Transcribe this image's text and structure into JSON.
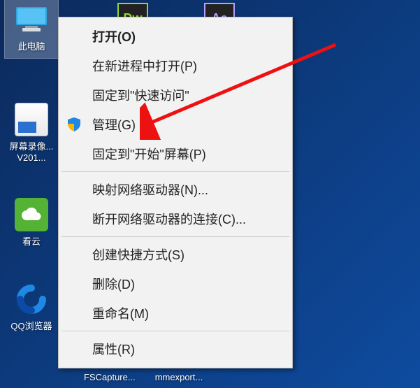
{
  "desktop": {
    "icons": [
      {
        "label": "此电脑",
        "kind": "this-pc",
        "selected": true
      },
      {
        "label": "屏幕录像...\nV201...",
        "kind": "recorder"
      },
      {
        "label": "看云",
        "kind": "cloud"
      },
      {
        "label": "QQ浏览器",
        "kind": "browser"
      }
    ],
    "topApps": [
      {
        "code": "Dw",
        "name": "dreamweaver"
      },
      {
        "code": "Ae",
        "name": "after-effects"
      }
    ],
    "bottomLabels": [
      "FSCapture...",
      "mmexport..."
    ]
  },
  "contextMenu": {
    "groups": [
      [
        {
          "id": "open",
          "label": "打开(O)",
          "bold": true
        },
        {
          "id": "open-new-process",
          "label": "在新进程中打开(P)"
        },
        {
          "id": "pin-quick-access",
          "label": "固定到\"快速访问\""
        },
        {
          "id": "manage",
          "label": "管理(G)",
          "shield": true
        },
        {
          "id": "pin-start",
          "label": "固定到\"开始\"屏幕(P)"
        }
      ],
      [
        {
          "id": "map-drive",
          "label": "映射网络驱动器(N)..."
        },
        {
          "id": "disconnect-drive",
          "label": "断开网络驱动器的连接(C)..."
        }
      ],
      [
        {
          "id": "create-shortcut",
          "label": "创建快捷方式(S)"
        },
        {
          "id": "delete",
          "label": "删除(D)"
        },
        {
          "id": "rename",
          "label": "重命名(M)"
        }
      ],
      [
        {
          "id": "properties",
          "label": "属性(R)"
        }
      ]
    ]
  },
  "annotation": {
    "arrowColor": "#e11"
  }
}
